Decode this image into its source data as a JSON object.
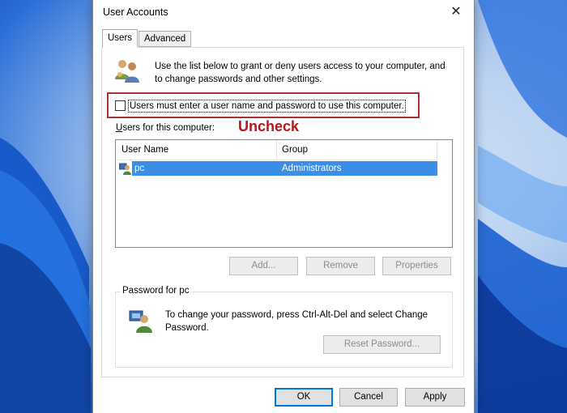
{
  "window": {
    "title": "User Accounts",
    "close_glyph": "✕"
  },
  "tabs": [
    {
      "label": "Users",
      "active": true
    },
    {
      "label": "Advanced",
      "active": false
    }
  ],
  "intro_text": "Use the list below to grant or deny users access to your computer, and to change passwords and other settings.",
  "must_enter_checkbox": {
    "label": "Users must enter a user name and password to use this computer.",
    "checked": false
  },
  "annotation": {
    "text": "Uncheck",
    "color": "#b3161b"
  },
  "users_list": {
    "label": "Users for this computer:",
    "columns": [
      "User Name",
      "Group"
    ],
    "rows": [
      {
        "user": "pc",
        "group": "Administrators",
        "selected": true
      }
    ]
  },
  "buttons": {
    "add": "Add...",
    "remove": "Remove",
    "properties": "Properties",
    "reset_password": "Reset Password...",
    "ok": "OK",
    "cancel": "Cancel",
    "apply": "Apply"
  },
  "password_group": {
    "title": "Password for pc",
    "text": "To change your password, press Ctrl-Alt-Del and select Change Password."
  },
  "icons": [
    "users-icon",
    "user-row-icon",
    "password-user-icon",
    "close-icon"
  ],
  "colors": {
    "selection": "#3a8ee6",
    "annotation_box": "#a83232",
    "default_button_border": "#0078d7"
  }
}
